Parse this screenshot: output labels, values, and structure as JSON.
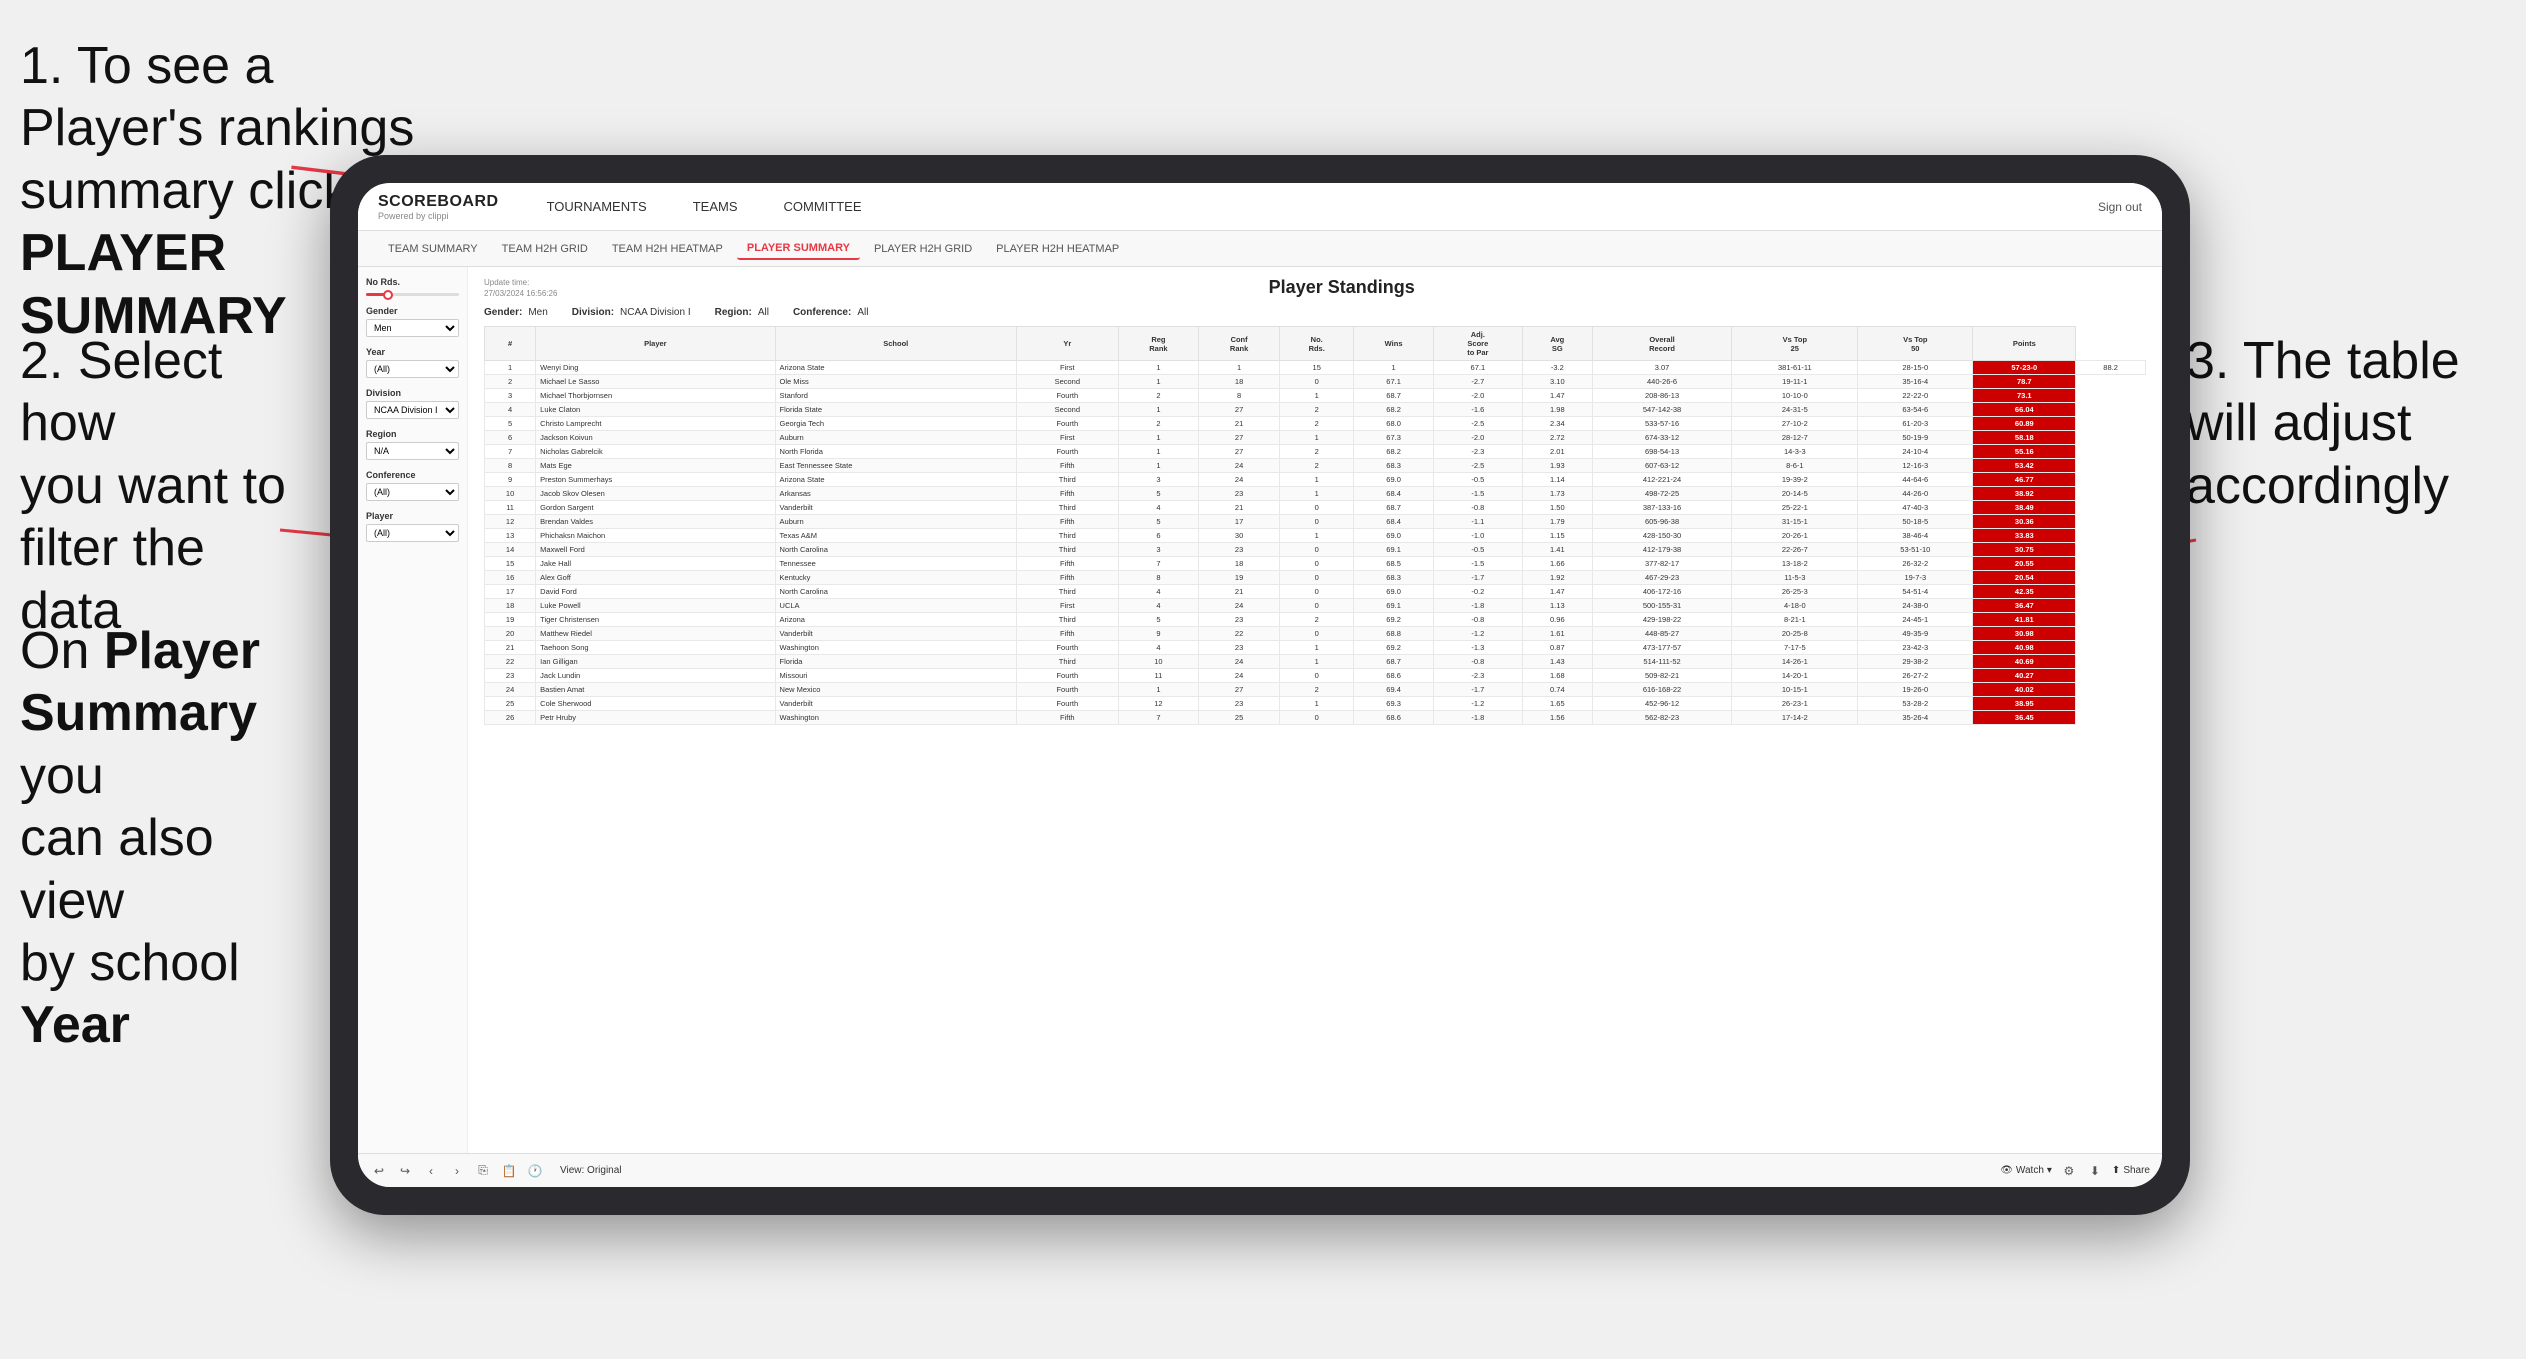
{
  "annotations": {
    "step1": "1. To see a Player's rankings summary click ",
    "step1_bold": "PLAYER SUMMARY",
    "step2_line1": "2. Select how",
    "step2_line2": "you want to",
    "step2_line3": "filter the data",
    "step3": "3. The table will adjust accordingly",
    "bottom_note_prefix": "On ",
    "bottom_note_bold1": "Player",
    "bottom_note_line2": "Summary",
    "bottom_note_suffix": " you can also view by school ",
    "bottom_note_bold2": "Year"
  },
  "nav": {
    "logo_main": "SCOREBOARD",
    "logo_sub": "Powered by clippi",
    "items": [
      "TOURNAMENTS",
      "TEAMS",
      "COMMITTEE"
    ],
    "sign_out": "Sign out"
  },
  "sub_nav": {
    "items": [
      "TEAM SUMMARY",
      "TEAM H2H GRID",
      "TEAM H2H HEATMAP",
      "PLAYER SUMMARY",
      "PLAYER H2H GRID",
      "PLAYER H2H HEATMAP"
    ]
  },
  "sidebar": {
    "no_rds_label": "No Rds.",
    "gender_label": "Gender",
    "gender_value": "Men",
    "year_label": "Year",
    "year_value": "(All)",
    "division_label": "Division",
    "division_value": "NCAA Division I",
    "region_label": "Region",
    "region_value": "N/A",
    "conference_label": "Conference",
    "conference_value": "(All)",
    "player_label": "Player",
    "player_value": "(All)"
  },
  "table": {
    "title": "Player Standings",
    "update_time": "Update time:\n27/03/2024 16:56:26",
    "filters": {
      "gender": "Men",
      "division": "NCAA Division I",
      "region": "All",
      "conference": "All"
    },
    "columns": [
      "#",
      "Player",
      "School",
      "Yr",
      "Reg Rank",
      "Conf Rank",
      "No. Rds.",
      "Wins",
      "Adj. Score to Par",
      "Avg SG",
      "Overall Record",
      "Vs Top 25",
      "Vs Top 50",
      "Points"
    ],
    "rows": [
      [
        "1",
        "Wenyi Ding",
        "Arizona State",
        "First",
        "1",
        "1",
        "15",
        "1",
        "67.1",
        "-3.2",
        "3.07",
        "381-61-11",
        "28-15-0",
        "57-23-0",
        "88.2"
      ],
      [
        "2",
        "Michael Le Sasso",
        "Ole Miss",
        "Second",
        "1",
        "18",
        "0",
        "67.1",
        "-2.7",
        "3.10",
        "440-26-6",
        "19-11-1",
        "35-16-4",
        "78.7"
      ],
      [
        "3",
        "Michael Thorbjornsen",
        "Stanford",
        "Fourth",
        "2",
        "8",
        "1",
        "68.7",
        "-2.0",
        "1.47",
        "208-86-13",
        "10-10-0",
        "22-22-0",
        "73.1"
      ],
      [
        "4",
        "Luke Claton",
        "Florida State",
        "Second",
        "1",
        "27",
        "2",
        "68.2",
        "-1.6",
        "1.98",
        "547-142-38",
        "24-31-5",
        "63-54-6",
        "66.04"
      ],
      [
        "5",
        "Christo Lamprecht",
        "Georgia Tech",
        "Fourth",
        "2",
        "21",
        "2",
        "68.0",
        "-2.5",
        "2.34",
        "533-57-16",
        "27-10-2",
        "61-20-3",
        "60.89"
      ],
      [
        "6",
        "Jackson Koivun",
        "Auburn",
        "First",
        "1",
        "27",
        "1",
        "67.3",
        "-2.0",
        "2.72",
        "674-33-12",
        "28-12-7",
        "50-19-9",
        "58.18"
      ],
      [
        "7",
        "Nicholas Gabrelcik",
        "North Florida",
        "Fourth",
        "1",
        "27",
        "2",
        "68.2",
        "-2.3",
        "2.01",
        "698-54-13",
        "14-3-3",
        "24-10-4",
        "55.16"
      ],
      [
        "8",
        "Mats Ege",
        "East Tennessee State",
        "Fifth",
        "1",
        "24",
        "2",
        "68.3",
        "-2.5",
        "1.93",
        "607-63-12",
        "8-6-1",
        "12-16-3",
        "53.42"
      ],
      [
        "9",
        "Preston Summerhays",
        "Arizona State",
        "Third",
        "3",
        "24",
        "1",
        "69.0",
        "-0.5",
        "1.14",
        "412-221-24",
        "19-39-2",
        "44-64-6",
        "46.77"
      ],
      [
        "10",
        "Jacob Skov Olesen",
        "Arkansas",
        "Fifth",
        "5",
        "23",
        "1",
        "68.4",
        "-1.5",
        "1.73",
        "498-72-25",
        "20-14-5",
        "44-26-0",
        "38.92"
      ],
      [
        "11",
        "Gordon Sargent",
        "Vanderbilt",
        "Third",
        "4",
        "21",
        "0",
        "68.7",
        "-0.8",
        "1.50",
        "387-133-16",
        "25-22-1",
        "47-40-3",
        "38.49"
      ],
      [
        "12",
        "Brendan Valdes",
        "Auburn",
        "Fifth",
        "5",
        "17",
        "0",
        "68.4",
        "-1.1",
        "1.79",
        "605-96-38",
        "31-15-1",
        "50-18-5",
        "30.36"
      ],
      [
        "13",
        "Phichaksn Maichon",
        "Texas A&M",
        "Third",
        "6",
        "30",
        "1",
        "69.0",
        "-1.0",
        "1.15",
        "428-150-30",
        "20-26-1",
        "38-46-4",
        "33.83"
      ],
      [
        "14",
        "Maxwell Ford",
        "North Carolina",
        "Third",
        "3",
        "23",
        "0",
        "69.1",
        "-0.5",
        "1.41",
        "412-179-38",
        "22-26-7",
        "53-51-10",
        "30.75"
      ],
      [
        "15",
        "Jake Hall",
        "Tennessee",
        "Fifth",
        "7",
        "18",
        "0",
        "68.5",
        "-1.5",
        "1.66",
        "377-82-17",
        "13-18-2",
        "26-32-2",
        "20.55"
      ],
      [
        "16",
        "Alex Goff",
        "Kentucky",
        "Fifth",
        "8",
        "19",
        "0",
        "68.3",
        "-1.7",
        "1.92",
        "467-29-23",
        "11-5-3",
        "19-7-3",
        "20.54"
      ],
      [
        "17",
        "David Ford",
        "North Carolina",
        "Third",
        "4",
        "21",
        "0",
        "69.0",
        "-0.2",
        "1.47",
        "406-172-16",
        "26-25-3",
        "54-51-4",
        "42.35"
      ],
      [
        "18",
        "Luke Powell",
        "UCLA",
        "First",
        "4",
        "24",
        "0",
        "69.1",
        "-1.8",
        "1.13",
        "500-155-31",
        "4-18-0",
        "24-38-0",
        "36.47"
      ],
      [
        "19",
        "Tiger Christensen",
        "Arizona",
        "Third",
        "5",
        "23",
        "2",
        "69.2",
        "-0.8",
        "0.96",
        "429-198-22",
        "8-21-1",
        "24-45-1",
        "41.81"
      ],
      [
        "20",
        "Matthew Riedel",
        "Vanderbilt",
        "Fifth",
        "9",
        "22",
        "0",
        "68.8",
        "-1.2",
        "1.61",
        "448-85-27",
        "20-25-8",
        "49-35-9",
        "30.98"
      ],
      [
        "21",
        "Taehoon Song",
        "Washington",
        "Fourth",
        "4",
        "23",
        "1",
        "69.2",
        "-1.3",
        "0.87",
        "473-177-57",
        "7-17-5",
        "23-42-3",
        "40.98"
      ],
      [
        "22",
        "Ian Gilligan",
        "Florida",
        "Third",
        "10",
        "24",
        "1",
        "68.7",
        "-0.8",
        "1.43",
        "514-111-52",
        "14-26-1",
        "29-38-2",
        "40.69"
      ],
      [
        "23",
        "Jack Lundin",
        "Missouri",
        "Fourth",
        "11",
        "24",
        "0",
        "68.6",
        "-2.3",
        "1.68",
        "509-82-21",
        "14-20-1",
        "26-27-2",
        "40.27"
      ],
      [
        "24",
        "Bastien Amat",
        "New Mexico",
        "Fourth",
        "1",
        "27",
        "2",
        "69.4",
        "-1.7",
        "0.74",
        "616-168-22",
        "10-15-1",
        "19-26-0",
        "40.02"
      ],
      [
        "25",
        "Cole Sherwood",
        "Vanderbilt",
        "Fourth",
        "12",
        "23",
        "1",
        "69.3",
        "-1.2",
        "1.65",
        "452-96-12",
        "26-23-1",
        "53-28-2",
        "38.95"
      ],
      [
        "26",
        "Petr Hruby",
        "Washington",
        "Fifth",
        "7",
        "25",
        "0",
        "68.6",
        "-1.8",
        "1.56",
        "562-82-23",
        "17-14-2",
        "35-26-4",
        "36.45"
      ]
    ]
  },
  "toolbar": {
    "view_label": "View: Original",
    "watch_label": "Watch",
    "share_label": "Share"
  }
}
